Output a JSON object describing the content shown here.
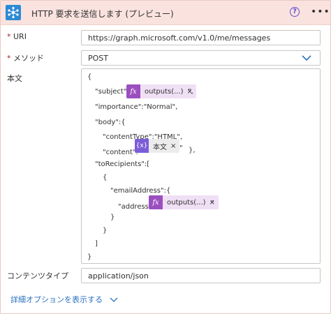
{
  "header": {
    "title": "HTTP 要求を送信します (プレビュー)"
  },
  "fields": {
    "uri_label": "URI",
    "uri_value": "https://graph.microsoft.com/v1.0/me/messages",
    "method_label": "メソッド",
    "method_value": "POST",
    "body_label": "本文",
    "content_type_label": "コンテンツタイプ",
    "content_type_value": "application/json",
    "required_mark": "*"
  },
  "body_json": {
    "open_brace": "{",
    "subject_key": "\"subject\":\"",
    "subject_tail": "\",",
    "importance_line": "\"importance\":\"Normal\",",
    "body_key": "\"body\":{",
    "content_type_line": "\"contentType\":\"HTML\",",
    "content_key": "\"content\":\"",
    "content_tail": "\"",
    "content_close": "},",
    "to_recipients_key": "\"toRecipients\":[",
    "inner_open": "{",
    "email_address_key": "\"emailAddress\":{",
    "address_key": "\"address\":\"",
    "address_tail": "\"",
    "inner_close1": "}",
    "inner_close2": "}",
    "array_close": "]",
    "close_brace": "}"
  },
  "tokens": {
    "subject": {
      "icon": "fx",
      "label": "outputs(...)",
      "remove": "×"
    },
    "content": {
      "icon": "{x}",
      "label": "本文",
      "remove": "×"
    },
    "address": {
      "icon": "fx",
      "label": "outputs(...)",
      "remove": "×"
    }
  },
  "footer": {
    "advanced_options": "詳細オプションを表示する"
  },
  "colors": {
    "header_bg": "#fae3df",
    "app_icon_bg": "#2c8ad4",
    "fx_token": "#9b4fbf",
    "var_token": "#7c5dd8",
    "link": "#2b72c2",
    "required": "#a4262c"
  }
}
